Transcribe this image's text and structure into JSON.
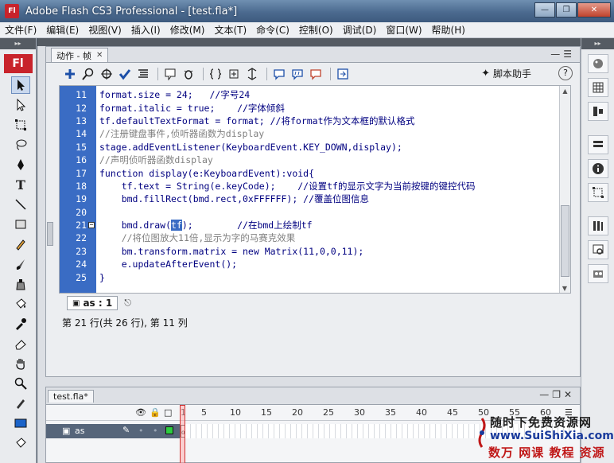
{
  "window": {
    "app_icon": "Fl",
    "title": "Adobe Flash CS3 Professional - [test.fla*]",
    "controls": [
      "minimize",
      "restore",
      "close"
    ]
  },
  "menubar": [
    {
      "label": "文件(F)"
    },
    {
      "label": "编辑(E)"
    },
    {
      "label": "视图(V)"
    },
    {
      "label": "插入(I)"
    },
    {
      "label": "修改(M)"
    },
    {
      "label": "文本(T)"
    },
    {
      "label": "命令(C)"
    },
    {
      "label": "控制(O)"
    },
    {
      "label": "调试(D)"
    },
    {
      "label": "窗口(W)"
    },
    {
      "label": "帮助(H)"
    }
  ],
  "tools_panel": {
    "badge": "Fl",
    "tools": [
      "selection-tool",
      "subselection-tool",
      "free-transform-tool",
      "lasso-tool",
      "pen-tool",
      "text-tool",
      "line-tool",
      "rectangle-tool",
      "pencil-tool",
      "brush-tool",
      "ink-bottle-tool",
      "paint-bucket-tool",
      "eyedropper-tool",
      "eraser-tool",
      "hand-tool",
      "zoom-tool",
      "stroke-color",
      "fill-color"
    ],
    "fill_color": "#1a63c9"
  },
  "actions_panel": {
    "tab_label": "动作 - 帧",
    "script_assist_label": "脚本助手",
    "help_label": "?",
    "code_lines": [
      {
        "num": "11",
        "code": "format.size = 24;   //字号24"
      },
      {
        "num": "12",
        "code": "format.italic = true;    //字体倾斜"
      },
      {
        "num": "13",
        "code": "tf.defaultTextFormat = format; //将format作为文本框的默认格式"
      },
      {
        "num": "14",
        "code": "//注册键盘事件,侦听器函数为display"
      },
      {
        "num": "15",
        "code": "stage.addEventListener(KeyboardEvent.KEY_DOWN,display);"
      },
      {
        "num": "16",
        "code": "//声明侦听器函数display"
      },
      {
        "num": "17",
        "code": "function display(e:KeyboardEvent):void{"
      },
      {
        "num": "18",
        "code": "    tf.text = String(e.keyCode);    //设置tf的显示文字为当前按键的键控代码"
      },
      {
        "num": "19",
        "code": "    bmd.fillRect(bmd.rect,0xFFFFFF); //覆盖位图信息"
      },
      {
        "num": "20",
        "code": ""
      },
      {
        "num": "21",
        "code_before": "    bmd.draw(",
        "code_selected": "tf",
        "code_after": ");        //在bmd上绘制tf"
      },
      {
        "num": "22",
        "code": "    //将位图放大11倍,显示为字的马赛克效果"
      },
      {
        "num": "23",
        "code": "    bm.transform.matrix = new Matrix(11,0,0,11);"
      },
      {
        "num": "24",
        "code": "    e.updateAfterEvent();"
      },
      {
        "num": "25",
        "code": "}"
      }
    ],
    "script_tab": "as : 1",
    "status_text": "第 21 行(共 26 行), 第 11 列"
  },
  "timeline": {
    "tab_label": "test.fla*",
    "frame_numbers": [
      "1",
      "5",
      "10",
      "15",
      "20",
      "25",
      "30",
      "35",
      "40",
      "45",
      "50",
      "55",
      "60"
    ],
    "layer_name": "as",
    "layer_color": "#2ecc40"
  },
  "watermark": {
    "line1": "随时下免费资源网",
    "line2": "www.SuiShiXia.com",
    "line3": "数万 网课 教程 资源"
  }
}
